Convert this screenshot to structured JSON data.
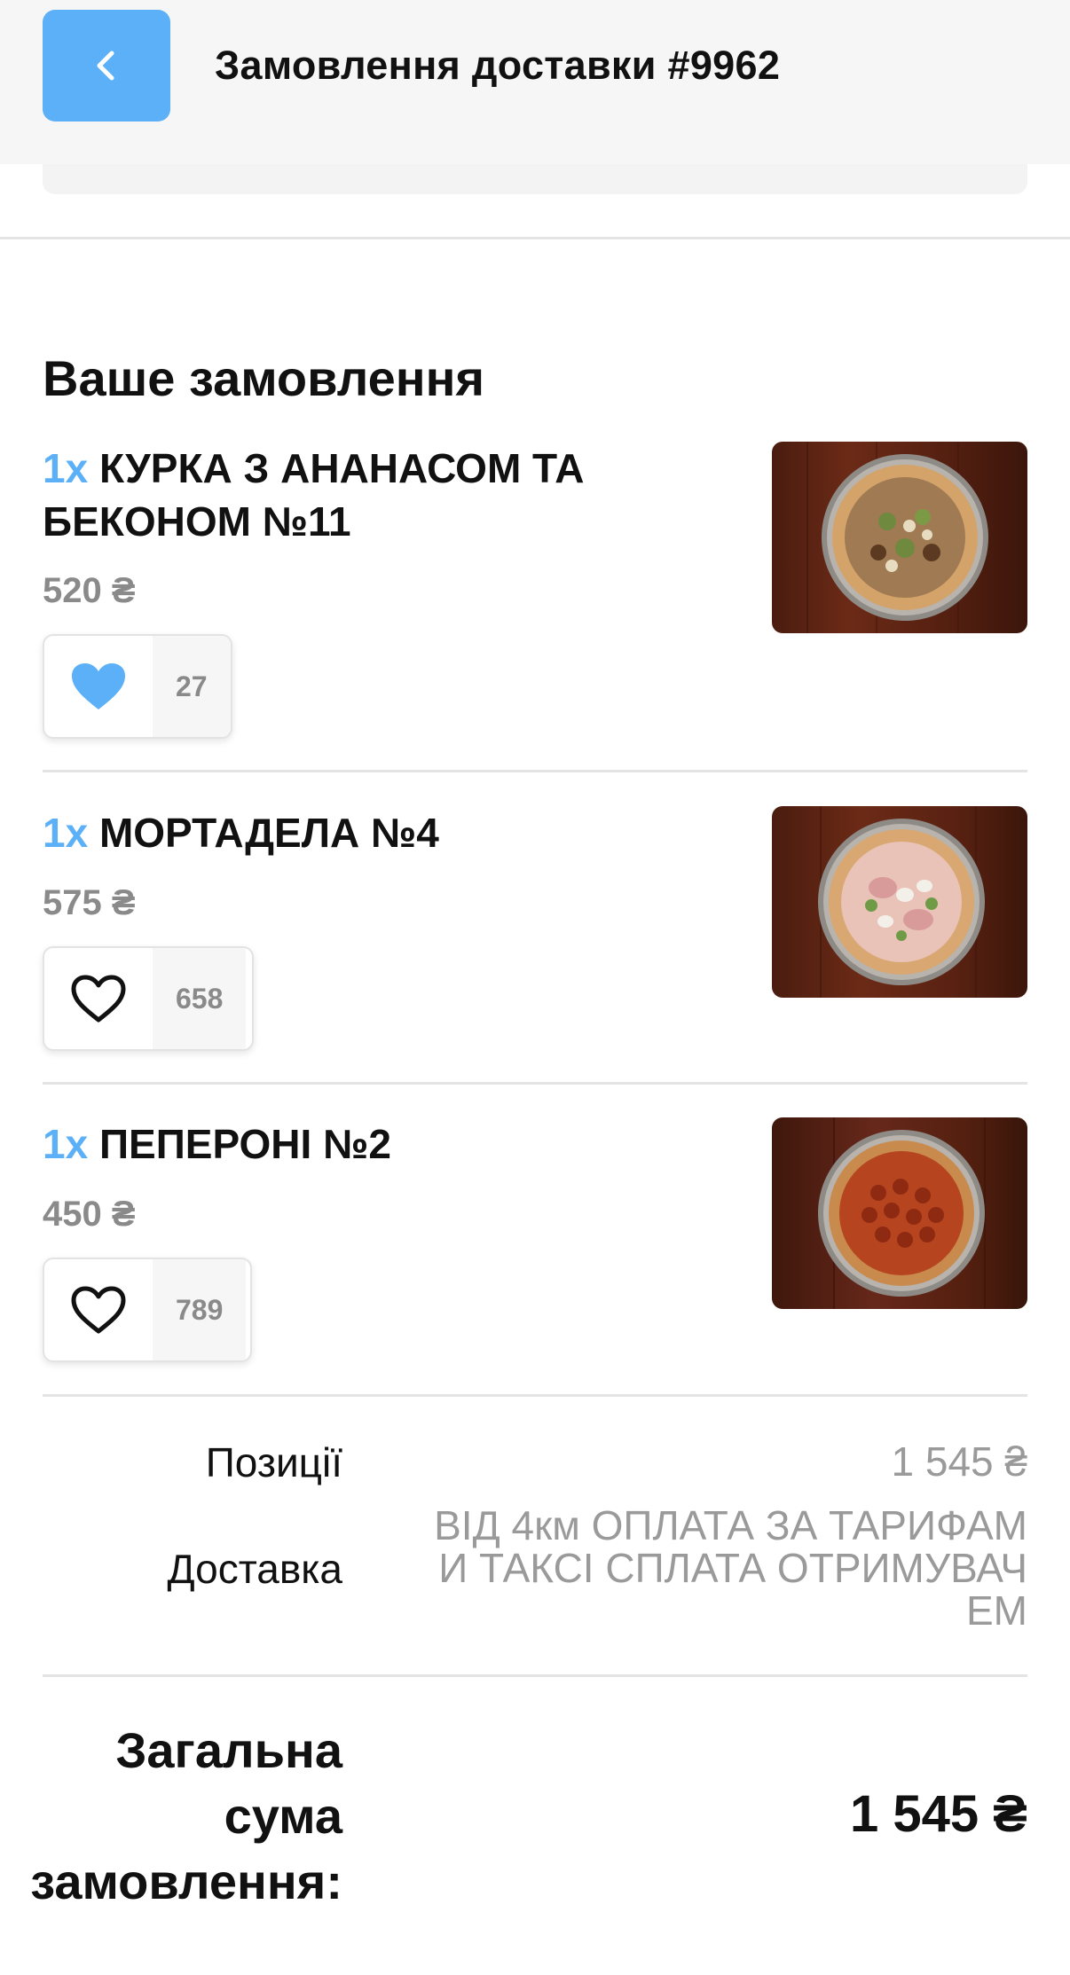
{
  "header": {
    "title": "Замовлення доставки #9962",
    "back_icon": "chevron-left-icon"
  },
  "order": {
    "section_title": "Ваше замовлення",
    "items": [
      {
        "qty": "1x",
        "name": "КУРКА З АНАНАСОМ ТА БЕКОНОМ №11",
        "price": "520 ₴",
        "likes": "27",
        "liked": true,
        "image": "pizza-chicken-pineapple-bacon"
      },
      {
        "qty": "1x",
        "name": "МОРТАДЕЛА №4",
        "price": "575 ₴",
        "likes": "658",
        "liked": false,
        "image": "pizza-mortadella"
      },
      {
        "qty": "1x",
        "name": "ПЕПЕРОНІ №2",
        "price": "450 ₴",
        "likes": "789",
        "liked": false,
        "image": "pizza-pepperoni"
      }
    ]
  },
  "summary": {
    "positions_label": "Позиції",
    "positions_value": "1 545 ₴",
    "delivery_label": "Доставка",
    "delivery_value_lines": [
      "ВІД 4км ОПЛАТА ЗА ТАРИФАМ",
      "И ТАКСІ СПЛАТА ОТРИМУВАЧ",
      "ЕМ"
    ],
    "total_label_lines": [
      "Загальна",
      "сума",
      "замовлення:"
    ],
    "total_value": "1 545 ₴"
  },
  "colors": {
    "accent": "#5bb0f7",
    "muted_text": "#8a8a8a",
    "divider": "#e4e4e4"
  }
}
